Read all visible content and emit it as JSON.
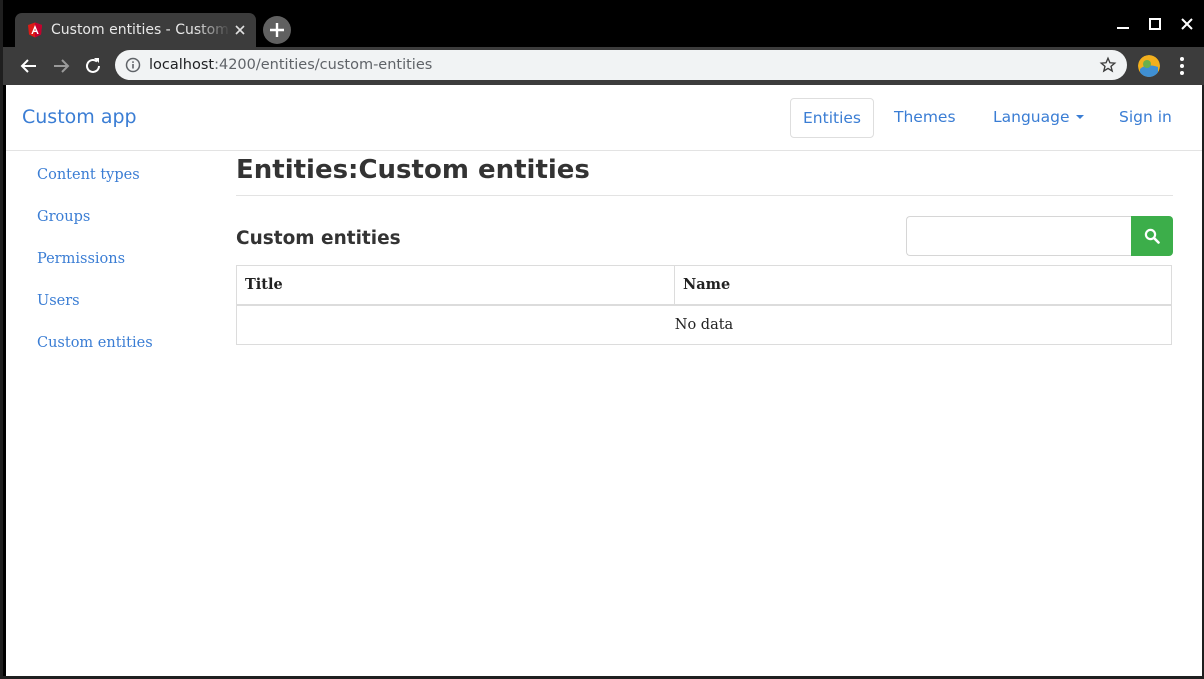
{
  "browser": {
    "tab_title": "Custom entities - Custom app",
    "url_host": "localhost",
    "url_path": ":4200/entities/custom-entities"
  },
  "navbar": {
    "brand": "Custom app",
    "items": [
      {
        "label": "Entities",
        "active": true
      },
      {
        "label": "Themes"
      },
      {
        "label": "Language"
      },
      {
        "label": "Sign in"
      }
    ]
  },
  "sidebar": {
    "items": [
      {
        "label": "Content types"
      },
      {
        "label": "Groups"
      },
      {
        "label": "Permissions"
      },
      {
        "label": "Users"
      },
      {
        "label": "Custom entities"
      }
    ]
  },
  "main": {
    "title": "Entities:Custom entities",
    "section_title": "Custom entities",
    "search": {
      "value": "",
      "placeholder": ""
    },
    "table": {
      "columns": [
        "Title",
        "Name"
      ],
      "empty_text": "No data"
    }
  },
  "colors": {
    "link": "#3a7dd4",
    "search_button": "#3cae4a"
  }
}
